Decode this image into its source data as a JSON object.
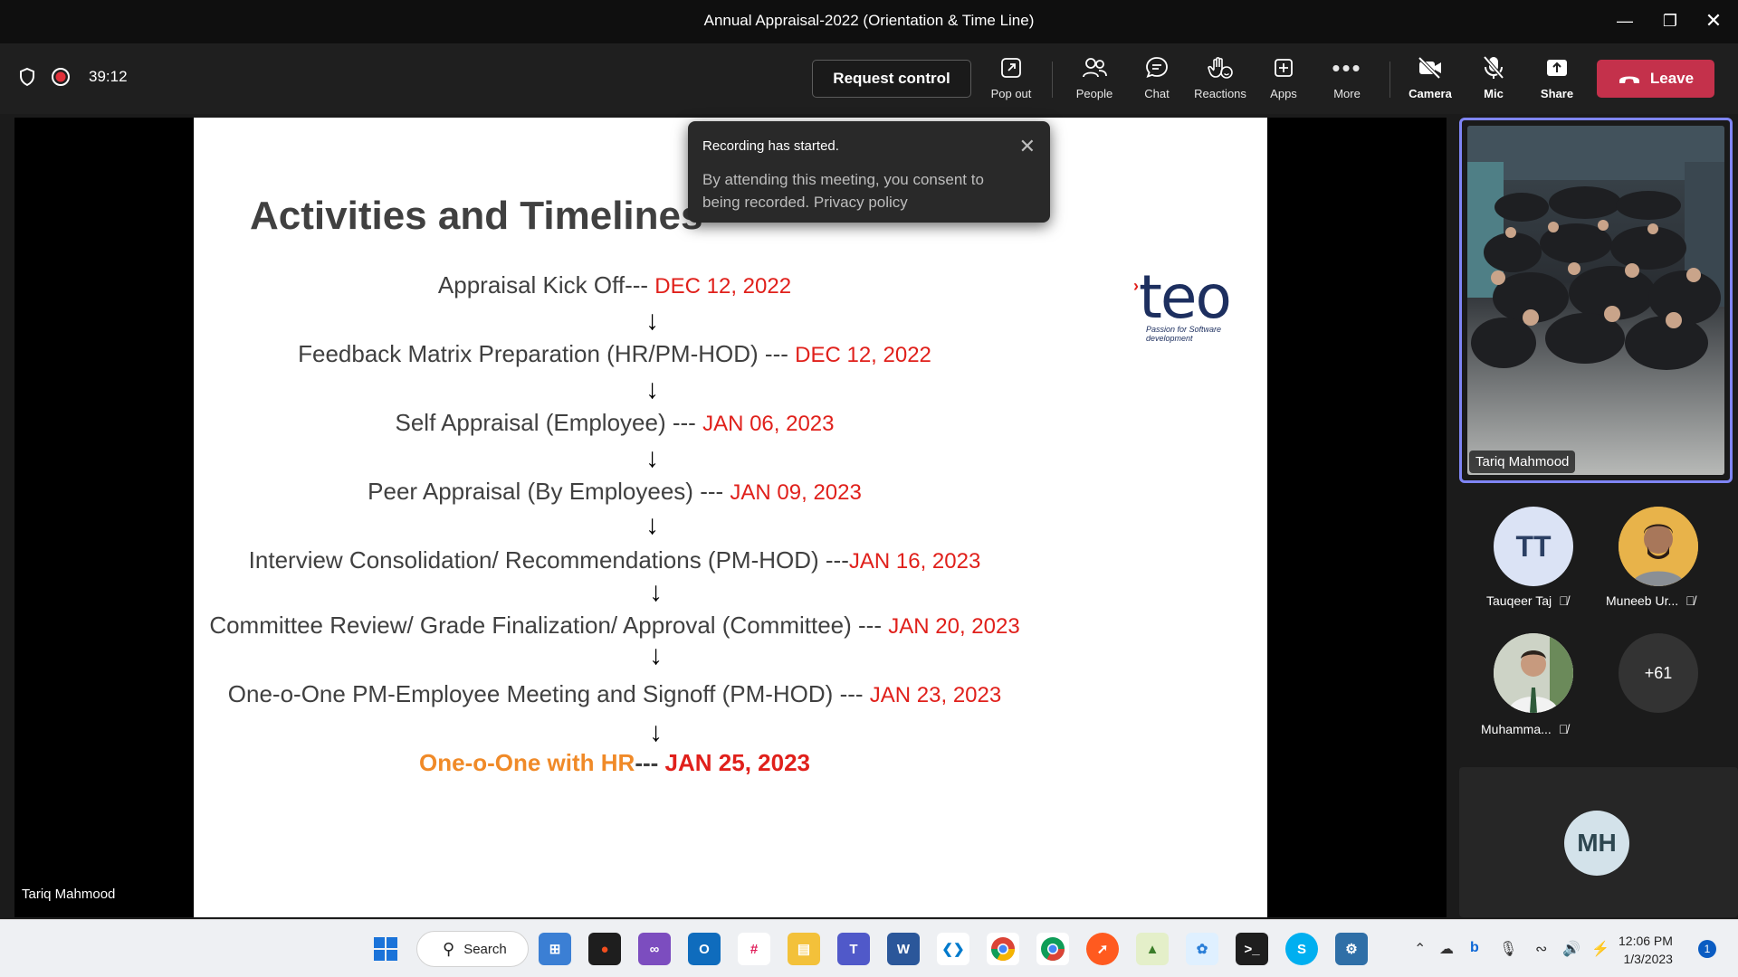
{
  "window": {
    "title": "Annual Appraisal-2022 (Orientation & Time Line)"
  },
  "toolbar": {
    "timer": "39:12",
    "request_control": "Request control",
    "pop_out": "Pop out",
    "people": "People",
    "chat": "Chat",
    "reactions": "Reactions",
    "apps": "Apps",
    "more": "More",
    "camera": "Camera",
    "mic": "Mic",
    "share": "Share",
    "leave": "Leave"
  },
  "slide": {
    "title": "Activities and Timelines",
    "logo_word": "teo",
    "logo_tagline": "Passion for Software development",
    "rows": [
      {
        "label": "Appraisal Kick Off---",
        "date": "DEC 12, 2022"
      },
      {
        "label": "Feedback Matrix Preparation (HR/PM-HOD) ---",
        "date": "DEC 12, 2022"
      },
      {
        "label": "Self Appraisal  (Employee) ---",
        "date": "JAN 06, 2023"
      },
      {
        "label": "Peer Appraisal  (By Employees) ---",
        "date": "JAN 09, 2023"
      },
      {
        "label": "Interview Consolidation/ Recommendations (PM-HOD) ---",
        "date": "JAN 16, 2023"
      },
      {
        "label": "Committee Review/ Grade Finalization/ Approval (Committee) ---",
        "date": "JAN 20, 2023"
      },
      {
        "label": "One-o-One PM-Employee Meeting and Signoff (PM-HOD) ---",
        "date": "JAN 23, 2023"
      }
    ],
    "final_row": {
      "label": "One-o-One with HR",
      "sep": "---",
      "date": "JAN 25, 2023"
    }
  },
  "presenter_name": "Tariq Mahmood",
  "toast": {
    "title": "Recording has started.",
    "body": "By attending this meeting, you consent to being recorded. Privacy policy"
  },
  "participants": {
    "video_name": "Tariq Mahmood",
    "p1": {
      "initials": "TT",
      "name": "Tauqeer Taj"
    },
    "p2": {
      "name": "Muneeb Ur..."
    },
    "p3": {
      "name": "Muhamma..."
    },
    "overflow": "+61",
    "p4": {
      "initials": "MH"
    }
  },
  "taskbar": {
    "search": "Search",
    "time": "12:06 PM",
    "date": "1/3/2023",
    "notifications": "1"
  }
}
